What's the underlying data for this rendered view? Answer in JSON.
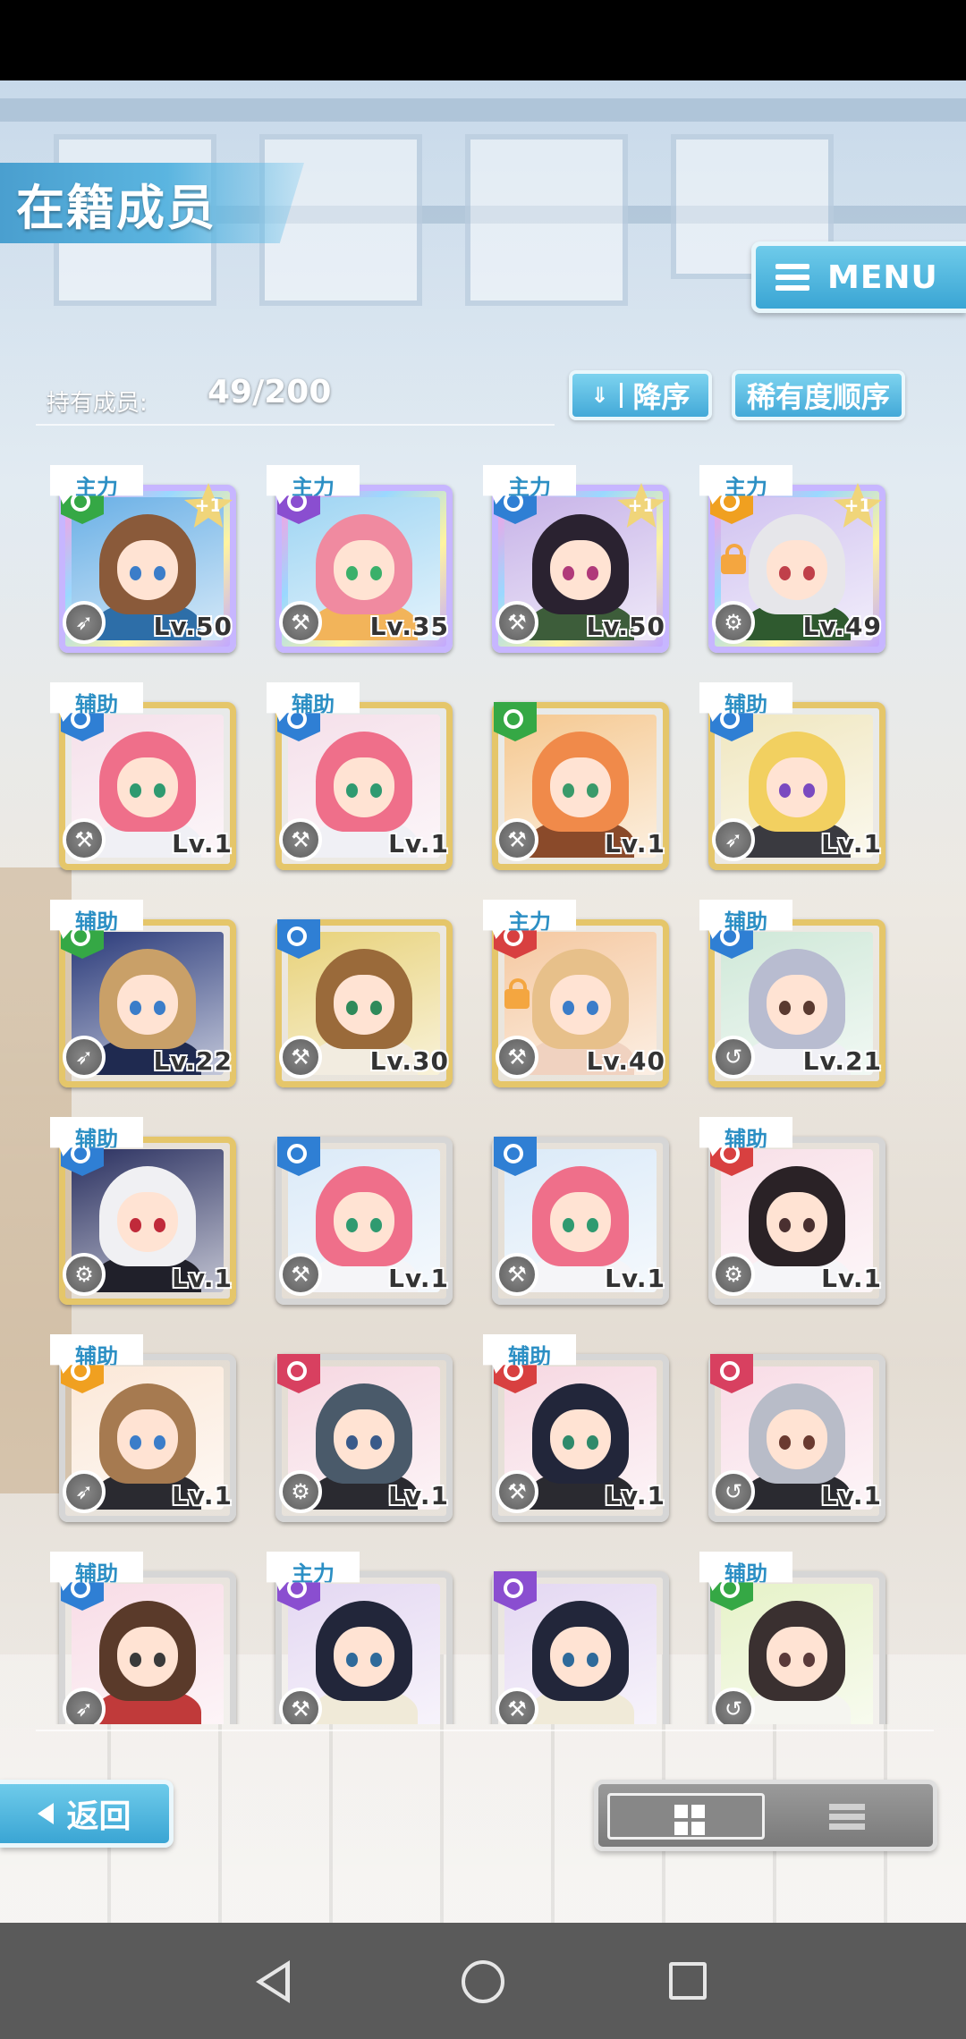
{
  "header": {
    "title": "在籍成员",
    "menu_label": "MENU"
  },
  "roster": {
    "count_label": "持有成员:",
    "count_value": "49/200"
  },
  "sort": {
    "order_label": "降序",
    "order_icon": "double-chevron-down-icon",
    "rarity_label": "稀有度顺序"
  },
  "colors": {
    "accent": "#3aa5d4",
    "role_text": "#2c8fc4"
  },
  "cards": [
    {
      "role": "主力",
      "level": "Lv.50",
      "plus": "+1",
      "frame": "rainbow",
      "weapon_icon": "rocket-icon",
      "attr_color": "#35a845",
      "hair": "#8a5a3a",
      "eye": "#3b7dc9",
      "bg": "#6ab0e6",
      "outfit": "#2d6ea8"
    },
    {
      "role": "主力",
      "level": "Lv.35",
      "plus": "",
      "frame": "rainbow",
      "weapon_icon": "hammer-icon",
      "attr_color": "#8a4ed0",
      "hair": "#f08aa0",
      "eye": "#3bb06a",
      "bg": "#9fd5f3",
      "outfit": "#f2b45a"
    },
    {
      "role": "主力",
      "level": "Lv.50",
      "plus": "+1",
      "frame": "rainbow",
      "weapon_icon": "wrench-icon",
      "attr_color": "#2f7fd4",
      "hair": "#2a2230",
      "eye": "#b03a7a",
      "bg": "#c7b3e8",
      "outfit": "#3d5d3a"
    },
    {
      "role": "主力",
      "level": "Lv.49",
      "plus": "+1",
      "frame": "rainbow",
      "weapon_icon": "gear-icon",
      "attr_color": "#f0a020",
      "hair": "#e6e6ea",
      "eye": "#c0404a",
      "bg": "#d0c2f0",
      "outfit": "#2f5a2f",
      "locked": true
    },
    {
      "role": "辅助",
      "level": "Lv.1",
      "plus": "",
      "frame": "gold",
      "weapon_icon": "hammer-icon",
      "attr_color": "#2f7fd4",
      "hair": "#ef6f8a",
      "eye": "#2f9a70",
      "bg": "#f5e0ea",
      "outfit": "#f0f0f5"
    },
    {
      "role": "辅助",
      "level": "Lv.1",
      "plus": "",
      "frame": "gold",
      "weapon_icon": "hammer-icon",
      "attr_color": "#2f7fd4",
      "hair": "#ef6f8a",
      "eye": "#2f9a70",
      "bg": "#f5e0ea",
      "outfit": "#f0f0f5"
    },
    {
      "role": "",
      "level": "Lv.1",
      "plus": "",
      "frame": "gold",
      "weapon_icon": "hammer-icon",
      "attr_color": "#35a845",
      "hair": "#f08a4a",
      "eye": "#3a9a6a",
      "bg": "#f5c890",
      "outfit": "#8a4a2a"
    },
    {
      "role": "辅助",
      "level": "Lv.1",
      "plus": "",
      "frame": "gold",
      "weapon_icon": "rocket-icon",
      "attr_color": "#2f7fd4",
      "hair": "#f2d060",
      "eye": "#7a4ac0",
      "bg": "#f0e7c0",
      "outfit": "#3a3a40"
    },
    {
      "role": "辅助",
      "level": "Lv.22",
      "plus": "",
      "frame": "gold",
      "weapon_icon": "rocket-icon",
      "attr_color": "#35a845",
      "hair": "#c9a068",
      "eye": "#3b7dc9",
      "bg": "#2a3a7a",
      "outfit": "#1f2a50"
    },
    {
      "role": "",
      "level": "Lv.30",
      "plus": "",
      "frame": "gold",
      "weapon_icon": "hammer-icon",
      "attr_color": "#2f7fd4",
      "hair": "#9a6a3a",
      "eye": "#2f8a5a",
      "bg": "#e8d27a",
      "outfit": "#f2ece0"
    },
    {
      "role": "主力",
      "level": "Lv.40",
      "plus": "",
      "frame": "gold",
      "weapon_icon": "wrench-icon",
      "attr_color": "#d84040",
      "hair": "#e7c08a",
      "eye": "#3b7dc9",
      "bg": "#f5c8a0",
      "outfit": "#f0d2c0",
      "locked": true
    },
    {
      "role": "辅助",
      "level": "Lv.21",
      "plus": "",
      "frame": "gold",
      "weapon_icon": "hook-icon",
      "attr_color": "#2f7fd4",
      "hair": "#b8bcd0",
      "eye": "#5a3a30",
      "bg": "#cfe8d8",
      "outfit": "#f0f0f5"
    },
    {
      "role": "辅助",
      "level": "Lv.1",
      "plus": "",
      "frame": "gold",
      "weapon_icon": "gear-icon",
      "attr_color": "#2f7fd4",
      "hair": "#f0f0f3",
      "eye": "#c02a3a",
      "bg": "#2a3060",
      "outfit": "#20202a"
    },
    {
      "role": "",
      "level": "Lv.1",
      "plus": "",
      "frame": "silver",
      "weapon_icon": "hammer-icon",
      "attr_color": "#2f7fd4",
      "hair": "#ef6f8a",
      "eye": "#2f9a70",
      "bg": "#dbeaf8",
      "outfit": "#f5f5f8"
    },
    {
      "role": "",
      "level": "Lv.1",
      "plus": "",
      "frame": "silver",
      "weapon_icon": "hammer-icon",
      "attr_color": "#2f7fd4",
      "hair": "#ef6f8a",
      "eye": "#2f9a70",
      "bg": "#dbeaf8",
      "outfit": "#f5f5f8"
    },
    {
      "role": "辅助",
      "level": "Lv.1",
      "plus": "",
      "frame": "silver",
      "weapon_icon": "gear-icon",
      "attr_color": "#d84040",
      "hair": "#2a2226",
      "eye": "#4a3030",
      "bg": "#f8e0e8",
      "outfit": "#f5f5f8"
    },
    {
      "role": "辅助",
      "level": "Lv.1",
      "plus": "",
      "frame": "silver",
      "weapon_icon": "rocket-icon",
      "attr_color": "#f0a020",
      "hair": "#a67a50",
      "eye": "#3b7dc9",
      "bg": "#fbe8d8",
      "outfit": "#2a2a30"
    },
    {
      "role": "",
      "level": "Lv.1",
      "plus": "",
      "frame": "silver",
      "weapon_icon": "gear-icon",
      "attr_color": "#d84060",
      "hair": "#4a5a6a",
      "eye": "#3a5a8a",
      "bg": "#f6d8e2",
      "outfit": "#2a2a30"
    },
    {
      "role": "辅助",
      "level": "Lv.1",
      "plus": "",
      "frame": "silver",
      "weapon_icon": "wrench-icon",
      "attr_color": "#d84040",
      "hair": "#22263a",
      "eye": "#2f8a6a",
      "bg": "#f6d8e2",
      "outfit": "#2a2a30"
    },
    {
      "role": "",
      "level": "Lv.1",
      "plus": "",
      "frame": "silver",
      "weapon_icon": "hook-icon",
      "attr_color": "#d84060",
      "hair": "#b8bcc8",
      "eye": "#6a3a30",
      "bg": "#f8dce6",
      "outfit": "#2a2a30"
    },
    {
      "role": "辅助",
      "level": "",
      "plus": "",
      "frame": "silver",
      "weapon_icon": "rocket-icon",
      "attr_color": "#2f7fd4",
      "hair": "#5a3a2a",
      "eye": "#3a3a3a",
      "bg": "#f8dce6",
      "outfit": "#c03a3a"
    },
    {
      "role": "主力",
      "level": "",
      "plus": "",
      "frame": "silver",
      "weapon_icon": "hammer-icon",
      "attr_color": "#8a4ed0",
      "hair": "#22263a",
      "eye": "#2f6a9a",
      "bg": "#e4d8f2",
      "outfit": "#f0ead8"
    },
    {
      "role": "",
      "level": "",
      "plus": "",
      "frame": "silver",
      "weapon_icon": "hammer-icon",
      "attr_color": "#8a4ed0",
      "hair": "#22263a",
      "eye": "#2f6a9a",
      "bg": "#e4d8f2",
      "outfit": "#f0ead8"
    },
    {
      "role": "辅助",
      "level": "",
      "plus": "",
      "frame": "silver",
      "weapon_icon": "hook-icon",
      "attr_color": "#35a845",
      "hair": "#3a3030",
      "eye": "#5a3a3a",
      "bg": "#e6f2c8",
      "outfit": "#f5f5f0"
    }
  ],
  "footer": {
    "back_label": "返回",
    "view_grid_icon": "grid-view-icon",
    "view_list_icon": "list-view-icon"
  },
  "navbar": {
    "back_icon": "nav-back-icon",
    "home_icon": "nav-home-icon",
    "recent_icon": "nav-recent-apps-icon"
  }
}
